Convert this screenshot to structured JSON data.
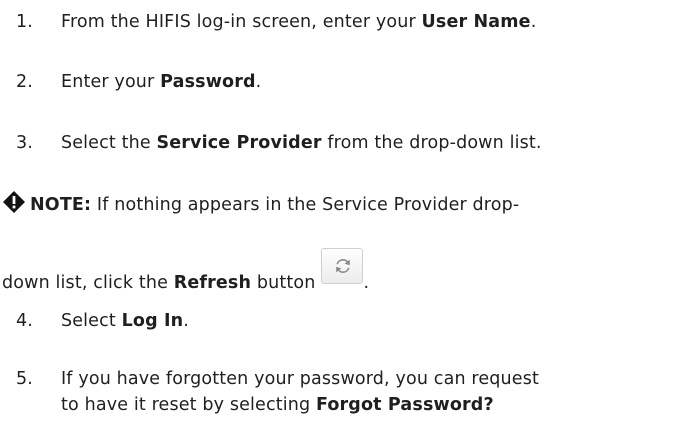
{
  "steps": [
    {
      "number": "1.",
      "pre": "From the HIFIS log-in screen, enter your ",
      "bold": "User Name",
      "post": "."
    },
    {
      "number": "2.",
      "pre": "Enter your ",
      "bold": "Password",
      "post": "."
    },
    {
      "number": "3.",
      "pre": "Select the ",
      "bold": "Service Provider",
      "post": " from the drop-down list."
    },
    {
      "number": "4.",
      "pre": "Select ",
      "bold": "Log In",
      "post": "."
    },
    {
      "number": "5.",
      "line1": "If you have forgotten your password, you can request",
      "line2_pre": "to have it reset by selecting ",
      "bold": "Forgot Password?"
    }
  ],
  "note": {
    "icon": "note-diamond-icon",
    "label": "NOTE:",
    "line1": " If nothing appears in the Service Provider drop-",
    "line2_pre": "down list, click the ",
    "bold": "Refresh",
    "line2_mid": " button",
    "line2_post": ".",
    "button_icon": "refresh-icon"
  },
  "colors": {
    "text": "#1f1f1f",
    "button_border": "#cfcfcf",
    "icon": "#8a8a8a"
  }
}
